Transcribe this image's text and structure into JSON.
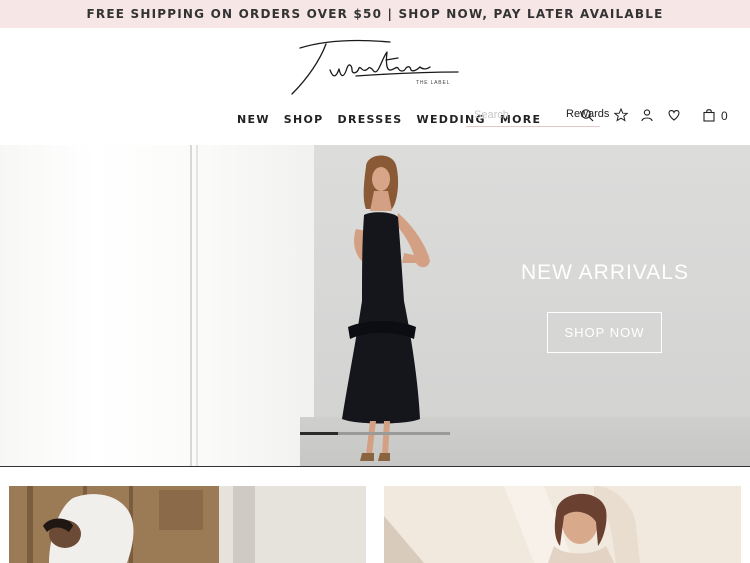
{
  "promo": {
    "text": "FREE SHIPPING ON ORDERS OVER $50 | SHOP NOW, PAY LATER AVAILABLE"
  },
  "brand": {
    "name": "Twosisters",
    "sub": "THE LABEL"
  },
  "nav": {
    "items": [
      "NEW",
      "SHOP",
      "DRESSES",
      "WEDDING",
      "MORE"
    ]
  },
  "header": {
    "search_placeholder": "Search",
    "rewards_label": "Rewards",
    "cart_count": "0",
    "icons": [
      "search-icon",
      "star-icon",
      "user-icon",
      "heart-icon",
      "bag-icon"
    ]
  },
  "hero": {
    "title": "NEW ARRIVALS",
    "cta_label": "SHOP NOW",
    "slide_progress": 0.25
  },
  "colors": {
    "promo_bg": "#f6e6e6",
    "text": "#222222",
    "hero_text": "#ffffff",
    "slider_active": "#2a2a2a",
    "slider_track": "#9a9a9a"
  }
}
